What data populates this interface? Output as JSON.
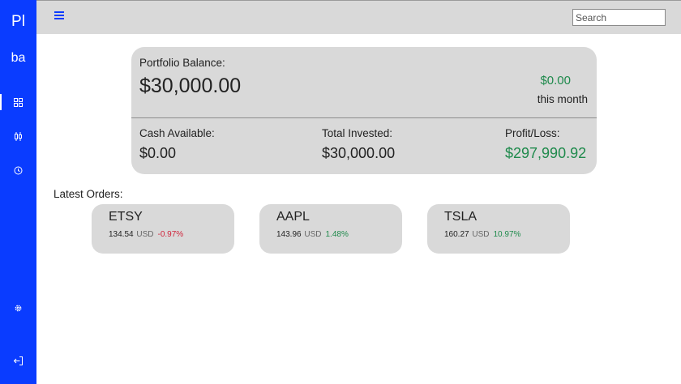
{
  "sidebar": {
    "logo_line1": "Pl",
    "logo_line2": "ba",
    "icons": [
      "dashboard-icon",
      "candlestick-icon",
      "history-icon",
      "settings-icon",
      "logout-icon"
    ]
  },
  "topbar": {
    "search_placeholder": "Search"
  },
  "balance": {
    "label": "Portfolio Balance:",
    "amount": "$30,000.00",
    "month_change": "$0.00",
    "month_label": "this month",
    "cash_label": "Cash Available:",
    "cash_value": "$0.00",
    "invested_label": "Total Invested:",
    "invested_value": "$30,000.00",
    "profit_label": "Profit/Loss:",
    "profit_value": "$297,990.92"
  },
  "orders": {
    "title": "Latest Orders:",
    "items": [
      {
        "symbol": "ETSY",
        "price": "134.54",
        "currency": "USD",
        "change": "-0.97%",
        "direction": "down"
      },
      {
        "symbol": "AAPL",
        "price": "143.96",
        "currency": "USD",
        "change": "1.48%",
        "direction": "up"
      },
      {
        "symbol": "TSLA",
        "price": "160.27",
        "currency": "USD",
        "change": "10.97%",
        "direction": "up"
      }
    ]
  },
  "colors": {
    "accent": "#0a3cff",
    "positive": "#1f8a4c",
    "negative": "#d0243b",
    "card": "#d9d9d9"
  }
}
